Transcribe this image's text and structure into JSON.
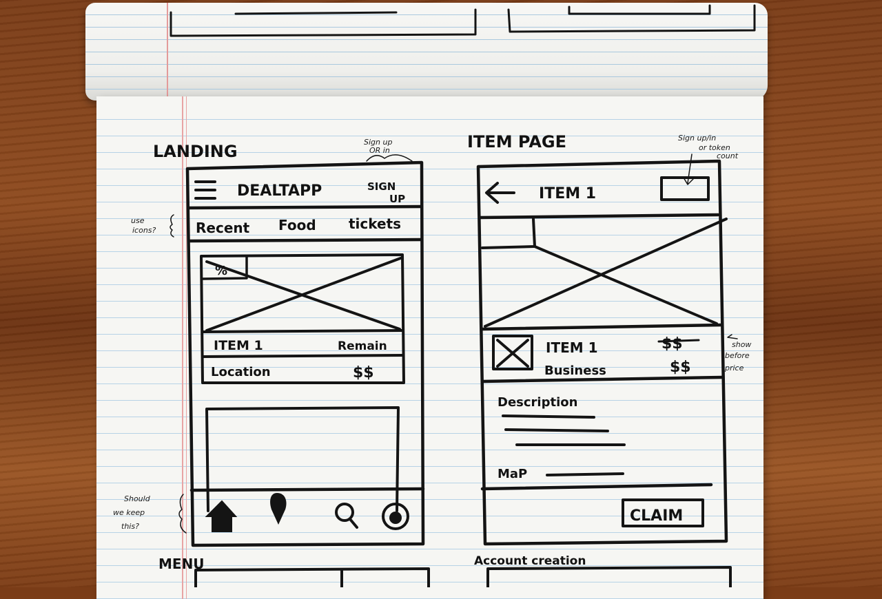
{
  "landing": {
    "title": "LANDING",
    "signup_note_line1": "Sign up",
    "signup_note_line2": "OR in",
    "app_name": "DEALTAPP",
    "signup_line1": "SIGN",
    "signup_line2": "UP",
    "tabs_note_line1": "use",
    "tabs_note_line2": "icons?",
    "tabs": [
      "Recent",
      "Food",
      "tickets"
    ],
    "card": {
      "badge": "%",
      "item": "ITEM 1",
      "remain": "Remain",
      "location": "Location",
      "price": "$$"
    },
    "bottom_note_line1": "Should",
    "bottom_note_line2": "we keep",
    "bottom_note_line3": "this?",
    "bottom_nav": [
      "home-icon",
      "pin-icon",
      "search-icon",
      "profile-icon"
    ]
  },
  "item_page": {
    "title": "ITEM PAGE",
    "signup_note_line1": "Sign up/in",
    "signup_note_line2": "or token",
    "signup_note_line3": "count",
    "back_icon": "arrow-left-icon",
    "item_title": "ITEM 1",
    "item_name": "ITEM 1",
    "business": "Business",
    "old_price": "$$",
    "price": "$$",
    "price_note_line1": "show",
    "price_note_line2": "before",
    "price_note_line3": "price",
    "description_label": "Description",
    "map_label": "MaP",
    "claim_label": "CLAIM"
  },
  "bottom_titles": {
    "menu": "MENU",
    "account": "Account creation"
  }
}
